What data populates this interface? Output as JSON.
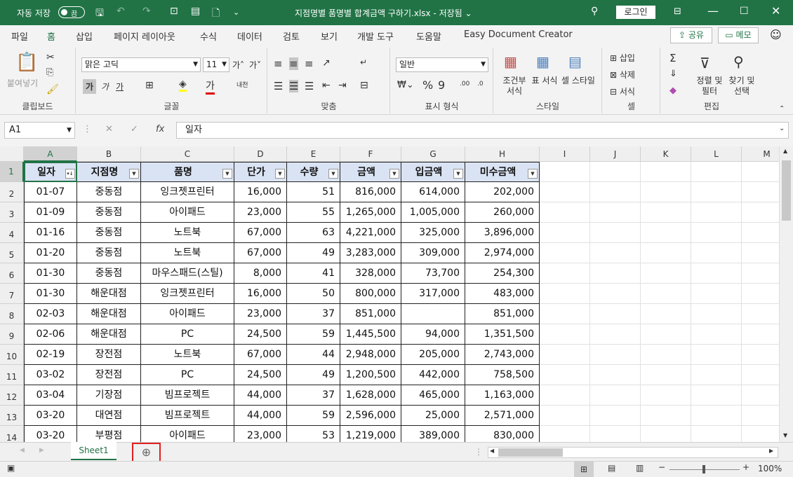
{
  "title_bar": {
    "autosave_label": "자동 저장",
    "autosave_state": "끔",
    "document_title": "지점명별 품명별 합계금액 구하기.xlsx - 저장됨 ⌄",
    "login_label": "로그인"
  },
  "ribbon_tabs": [
    "파일",
    "홈",
    "삽입",
    "페이지 레이아웃",
    "수식",
    "데이터",
    "검토",
    "보기",
    "개발 도구",
    "도움말",
    "Easy Document Creator"
  ],
  "share_label": "공유",
  "memo_label": "메모",
  "ribbon": {
    "clipboard": {
      "paste_label": "붙여넣기",
      "group_label": "클립보드"
    },
    "font": {
      "font_name": "맑은 고딕",
      "font_size": "11",
      "bold": "가",
      "italic": "가",
      "underline": "가",
      "group_label": "글꼴"
    },
    "alignment": {
      "group_label": "맞춤"
    },
    "number": {
      "format": "일반",
      "group_label": "표시 형식"
    },
    "styles": {
      "conditional": "조건부 서식",
      "table": "표 서식",
      "cell": "셀 스타일",
      "group_label": "스타일"
    },
    "cells": {
      "insert": "삽입",
      "delete": "삭제",
      "format": "서식",
      "group_label": "셀"
    },
    "editing": {
      "sort": "정렬 및 필터",
      "find": "찾기 및 선택",
      "group_label": "편집"
    }
  },
  "formula_bar": {
    "name_box": "A1",
    "formula": "일자"
  },
  "columns": [
    "A",
    "B",
    "C",
    "D",
    "E",
    "F",
    "G",
    "H",
    "I",
    "J",
    "K",
    "L",
    "M"
  ],
  "table": {
    "headers": [
      "일자",
      "지점명",
      "품명",
      "단가",
      "수량",
      "금액",
      "입금액",
      "미수금액"
    ],
    "rows": [
      [
        "01-07",
        "중동점",
        "잉크젯프린터",
        "16,000",
        "51",
        "816,000",
        "614,000",
        "202,000"
      ],
      [
        "01-09",
        "중동점",
        "아이패드",
        "23,000",
        "55",
        "1,265,000",
        "1,005,000",
        "260,000"
      ],
      [
        "01-16",
        "중동점",
        "노트북",
        "67,000",
        "63",
        "4,221,000",
        "325,000",
        "3,896,000"
      ],
      [
        "01-20",
        "중동점",
        "노트북",
        "67,000",
        "49",
        "3,283,000",
        "309,000",
        "2,974,000"
      ],
      [
        "01-30",
        "중동점",
        "마우스패드(스틸)",
        "8,000",
        "41",
        "328,000",
        "73,700",
        "254,300"
      ],
      [
        "01-30",
        "해운대점",
        "잉크젯프린터",
        "16,000",
        "50",
        "800,000",
        "317,000",
        "483,000"
      ],
      [
        "02-03",
        "해운대점",
        "아이패드",
        "23,000",
        "37",
        "851,000",
        "",
        "851,000"
      ],
      [
        "02-06",
        "해운대점",
        "PC",
        "24,500",
        "59",
        "1,445,500",
        "94,000",
        "1,351,500"
      ],
      [
        "02-19",
        "장전점",
        "노트북",
        "67,000",
        "44",
        "2,948,000",
        "205,000",
        "2,743,000"
      ],
      [
        "03-02",
        "장전점",
        "PC",
        "24,500",
        "49",
        "1,200,500",
        "442,000",
        "758,500"
      ],
      [
        "03-04",
        "기장점",
        "빔프로젝트",
        "44,000",
        "37",
        "1,628,000",
        "465,000",
        "1,163,000"
      ],
      [
        "03-20",
        "대연점",
        "빔프로젝트",
        "44,000",
        "59",
        "2,596,000",
        "25,000",
        "2,571,000"
      ],
      [
        "03-20",
        "부평점",
        "아이패드",
        "23,000",
        "53",
        "1,219,000",
        "389,000",
        "830,000"
      ]
    ]
  },
  "sheet_tab": "Sheet1",
  "zoom": "100%"
}
